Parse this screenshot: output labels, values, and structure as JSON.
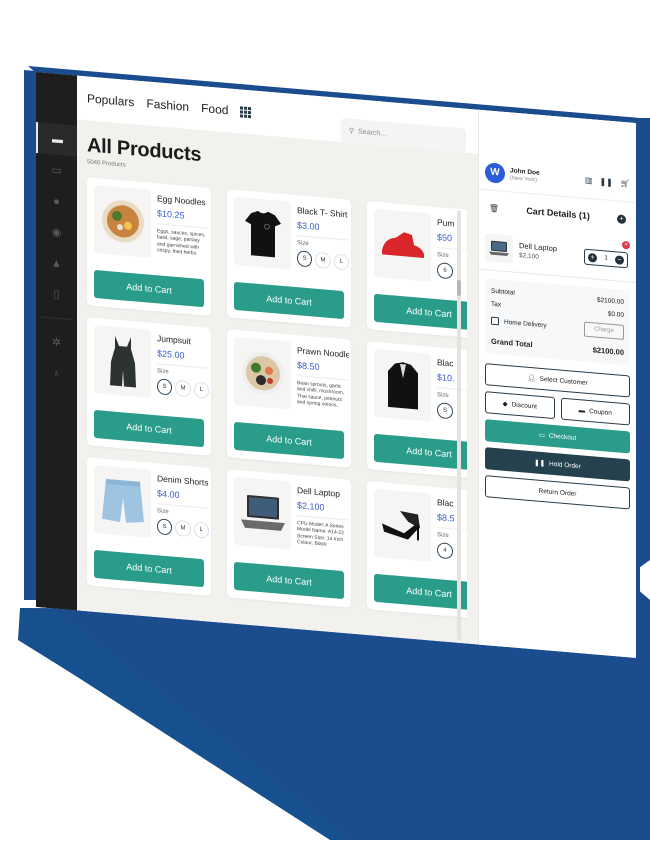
{
  "nav": {
    "categories": [
      "Populars",
      "Fashion",
      "Food"
    ],
    "search_placeholder": "Search..."
  },
  "sidebar": {
    "items": [
      {
        "icon": "pos-icon",
        "active": true
      },
      {
        "icon": "receipt-icon",
        "active": false
      },
      {
        "icon": "lightbulb-icon",
        "active": false
      },
      {
        "icon": "users-icon",
        "active": false
      },
      {
        "icon": "user-icon",
        "active": false
      },
      {
        "icon": "document-icon",
        "active": false
      },
      {
        "icon": "settings-icon",
        "active": false
      },
      {
        "icon": "award-icon",
        "active": false
      }
    ]
  },
  "page": {
    "title": "All Products",
    "count": "5040 Products"
  },
  "products": [
    {
      "name": "Egg Noodles",
      "price": "$10.25",
      "type": "desc",
      "desc": "Eggs, sauces, spices, basil, sage, parsley and garnished with crispy, fried herbs.",
      "image": "noodle-bowl"
    },
    {
      "name": "Black T- Shirt",
      "price": "$3.00",
      "type": "size",
      "size_label": "Size",
      "sizes": [
        "S",
        "M",
        "L"
      ],
      "image": "tshirt"
    },
    {
      "name": "Pum",
      "price": "$50",
      "type": "size",
      "size_label": "Size",
      "sizes": [
        "6"
      ],
      "image": "sneaker"
    },
    {
      "name": "Jumpsuit",
      "price": "$25.00",
      "type": "size",
      "size_label": "Size",
      "sizes": [
        "S",
        "M",
        "L"
      ],
      "image": "jumpsuit"
    },
    {
      "name": "Prawn Noodles",
      "price": "$8.50",
      "type": "desc",
      "desc": "Bean sprouts, garlic and chilli, mushroom, Thai sauce, peanuts and spring onions.",
      "image": "salad-bowl"
    },
    {
      "name": "Blac",
      "price": "$10.",
      "type": "size",
      "size_label": "Size",
      "sizes": [
        "S"
      ],
      "image": "blazer"
    },
    {
      "name": "Denim Shorts",
      "price": "$4.00",
      "type": "size",
      "size_label": "Size",
      "sizes": [
        "S",
        "M",
        "L"
      ],
      "image": "shorts"
    },
    {
      "name": "Dell Laptop",
      "price": "$2,100",
      "type": "desc",
      "desc": "CPU Model: A Series Model Name: A14-22 Screen Size: 14 Inch Colour: Black",
      "image": "laptop"
    },
    {
      "name": "Blac",
      "price": "$8.5",
      "type": "size",
      "size_label": "Size",
      "sizes": [
        "4"
      ],
      "image": "heels"
    }
  ],
  "add_to_cart_label": "Add to Cart",
  "cart": {
    "user_initial": "W",
    "user_name": "John Doe",
    "user_location": "(New York)",
    "title": "Cart Details (1)",
    "items": [
      {
        "name": "Dell Laptop",
        "price": "$2,100",
        "qty": "1"
      }
    ],
    "subtotal_label": "Subtotal",
    "subtotal": "$2100.00",
    "tax_label": "Tax",
    "tax": "$0.00",
    "home_delivery_label": "Home Delivery",
    "charge_label": "Charge",
    "grand_total_label": "Grand Total",
    "grand_total": "$2100.00",
    "actions": {
      "select_customer": "Select Customer",
      "discount": "Discount",
      "coupon": "Coupon",
      "checkout": "Checkout",
      "hold": "Hold Order",
      "return": "Return Order"
    }
  },
  "colors": {
    "accent": "#2a9d8a",
    "dark": "#24414d",
    "brand_blue": "#1b4d8e",
    "price": "#3a5bd0",
    "danger": "#e0394b"
  }
}
